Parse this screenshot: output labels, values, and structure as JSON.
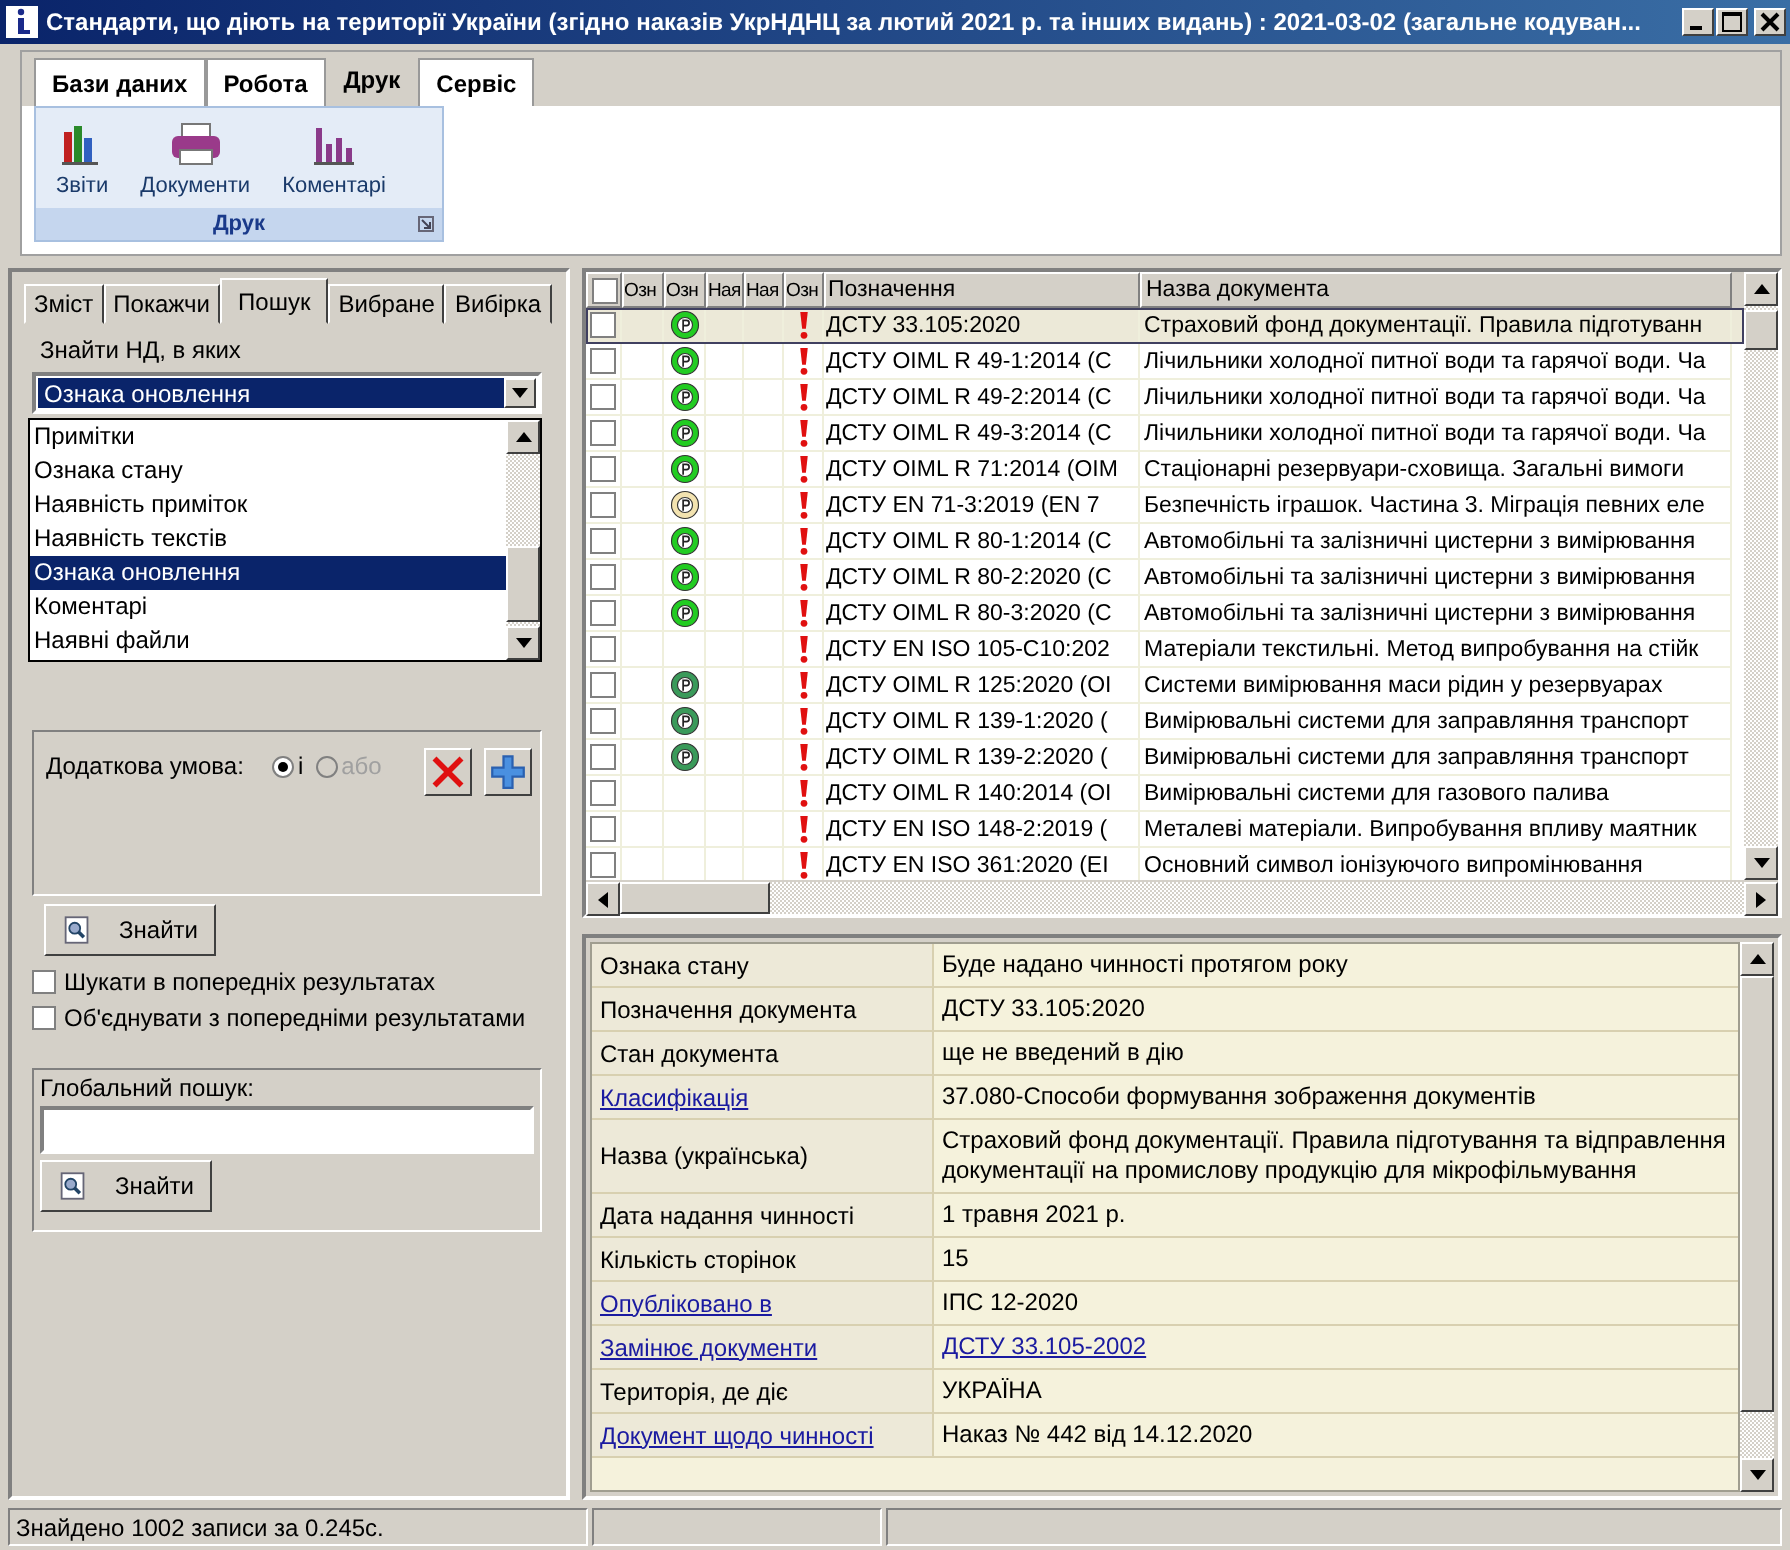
{
  "window": {
    "title": "Стандарти, що діють на території України (згідно наказів УкрНДНЦ  за лютий 2021 р. та інших видань) : 2021-03-02 (загальне кодуван..."
  },
  "ribbon": {
    "tabs": [
      {
        "label": "Бази даних",
        "selected": false
      },
      {
        "label": "Робота",
        "selected": false
      },
      {
        "label": "Друк",
        "selected": true
      },
      {
        "label": "Сервіс",
        "selected": false
      }
    ],
    "group": {
      "label": "Друк",
      "buttons": [
        {
          "kind": "reports",
          "label": "Звіти"
        },
        {
          "kind": "print",
          "label": "Документи"
        },
        {
          "kind": "comments",
          "label": "Коментарі"
        }
      ]
    }
  },
  "left_panel": {
    "tabs": [
      {
        "label": "Зміст",
        "selected": false
      },
      {
        "label": "Покажчи",
        "selected": false
      },
      {
        "label": "Пошук",
        "selected": true
      },
      {
        "label": "Вибране",
        "selected": false
      },
      {
        "label": "Вибірка",
        "selected": false
      }
    ],
    "find_label": "Знайти НД, в яких",
    "combo_value": "Ознака оновлення",
    "dropdown_items": [
      {
        "label": "Примітки",
        "selected": false
      },
      {
        "label": "Ознака стану",
        "selected": false
      },
      {
        "label": "Наявність приміток",
        "selected": false
      },
      {
        "label": "Наявність текстів",
        "selected": false
      },
      {
        "label": "Ознака оновлення",
        "selected": true
      },
      {
        "label": "Коментарі",
        "selected": false
      },
      {
        "label": "Наявні файли",
        "selected": false
      }
    ],
    "condition": {
      "label": "Додаткова умова:",
      "options": [
        {
          "label": "і",
          "selected": true,
          "disabled": false
        },
        {
          "label": "або",
          "selected": false,
          "disabled": true
        }
      ]
    },
    "find_button": "Знайти",
    "checkboxes": [
      {
        "label": "Шукати в попередніх результатах",
        "checked": false
      },
      {
        "label": "Об'єднувати з попередніми результатами",
        "checked": false
      }
    ],
    "global_search": {
      "label": "Глобальний пошук:",
      "button": "Знайти"
    }
  },
  "table": {
    "all_checked": false,
    "columns": [
      "Озн",
      "Озн",
      "Ная",
      "Ная",
      "Озн",
      "Позначення",
      "Назва документа"
    ],
    "rows": [
      {
        "checked": false,
        "selected": true,
        "color": "#22cc22",
        "designation": "ДСТУ 33.105:2020",
        "name": "Страховий фонд документації. Правила підготуванн"
      },
      {
        "checked": false,
        "selected": false,
        "color": "#22cc22",
        "designation": "ДСТУ OIML R 49-1:2014 (С",
        "name": "Лічильники холодної питної води та гарячої води. Ча"
      },
      {
        "checked": false,
        "selected": false,
        "color": "#22cc22",
        "designation": "ДСТУ OIML R 49-2:2014 (С",
        "name": "Лічильники холодної питної води та гарячої води. Ча"
      },
      {
        "checked": false,
        "selected": false,
        "color": "#22cc22",
        "designation": "ДСТУ OIML R 49-3:2014 (С",
        "name": "Лічильники холодної питної води та гарячої води. Ча"
      },
      {
        "checked": false,
        "selected": false,
        "color": "#22cc22",
        "designation": "ДСТУ OIML R 71:2014 (OIM",
        "name": "Стаціонарні резервуари-сховища. Загальні вимоги"
      },
      {
        "checked": false,
        "selected": false,
        "color": "#f3e3b0",
        "designation": "ДСТУ EN 71-3:2019 (EN 7",
        "name": "Безпечність іграшок. Частина 3. Міграція певних еле"
      },
      {
        "checked": false,
        "selected": false,
        "color": "#22cc22",
        "designation": "ДСТУ OIML R 80-1:2014 (С",
        "name": "Автомобільні та залізничні цистерни з вимірювання"
      },
      {
        "checked": false,
        "selected": false,
        "color": "#22cc22",
        "designation": "ДСТУ OIML R 80-2:2020 (С",
        "name": "Автомобільні та залізничні цистерни з вимірювання"
      },
      {
        "checked": false,
        "selected": false,
        "color": "#22cc22",
        "designation": "ДСТУ OIML R 80-3:2020 (С",
        "name": "Автомобільні та залізничні цистерни з вимірювання"
      },
      {
        "checked": false,
        "selected": false,
        "designation": "ДСТУ EN ISO 105-C10:202",
        "name": "Матеріали текстильні. Метод випробування на стійк"
      },
      {
        "checked": false,
        "selected": false,
        "color": "#3a9a5a",
        "designation": "ДСТУ OIML R 125:2020 (OI",
        "name": "Системи вимірювання маси рідин у резервуарах"
      },
      {
        "checked": false,
        "selected": false,
        "color": "#3a9a5a",
        "designation": "ДСТУ OIML R 139-1:2020 (",
        "name": "Вимірювальні системи для заправляння транспорт"
      },
      {
        "checked": false,
        "selected": false,
        "color": "#3a9a5a",
        "designation": "ДСТУ OIML R 139-2:2020 (",
        "name": "Вимірювальні системи для заправляння транспорт"
      },
      {
        "checked": false,
        "selected": false,
        "designation": "ДСТУ OIML R 140:2014 (OI",
        "name": "Вимірювальні системи для газового палива"
      },
      {
        "checked": false,
        "selected": false,
        "designation": "ДСТУ EN ISO 148-2:2019 (",
        "name": "Металеві матеріали. Випробування впливу маятник"
      },
      {
        "checked": false,
        "selected": false,
        "designation": "ДСТУ EN ISO 361:2020 (EI",
        "name": "Основний символ іонізуючого випромінювання"
      }
    ]
  },
  "details": [
    {
      "label": "Ознака стану",
      "label_link": false,
      "value": "Буде надано чинності протягом року",
      "value_link": false
    },
    {
      "label": "Позначення документа",
      "label_link": false,
      "value": "ДСТУ 33.105:2020",
      "value_link": false
    },
    {
      "label": "Стан документа",
      "label_link": false,
      "value": "ще не введений в дію",
      "value_link": false
    },
    {
      "label": "Класифікація",
      "label_link": true,
      "value": "37.080-Способи формування зображення документів",
      "value_link": false
    },
    {
      "label": "Назва (українська)",
      "label_link": false,
      "value": "Страховий фонд документації. Правила підготування та відправлення документації на промислову продукцію для мікрофільмування",
      "value_link": false
    },
    {
      "label": "Дата надання чинності",
      "label_link": false,
      "value": "1 травня 2021 р.",
      "value_link": false
    },
    {
      "label": "Кількість сторінок",
      "label_link": false,
      "value": "15",
      "value_link": false
    },
    {
      "label": "Опубліковано в",
      "label_link": true,
      "value": "ІПС 12-2020",
      "value_link": false
    },
    {
      "label": "Замінює документи",
      "label_link": true,
      "value": "ДСТУ 33.105-2002",
      "value_link": true
    },
    {
      "label": "Територія, де діє",
      "label_link": false,
      "value": "УКРАЇНА",
      "value_link": false
    },
    {
      "label": "Документ щодо чинності",
      "label_link": true,
      "value": "Наказ № 442 від 14.12.2020",
      "value_link": false
    }
  ],
  "status_bar": {
    "text": "Знайдено 1002 записи за 0.245с."
  }
}
